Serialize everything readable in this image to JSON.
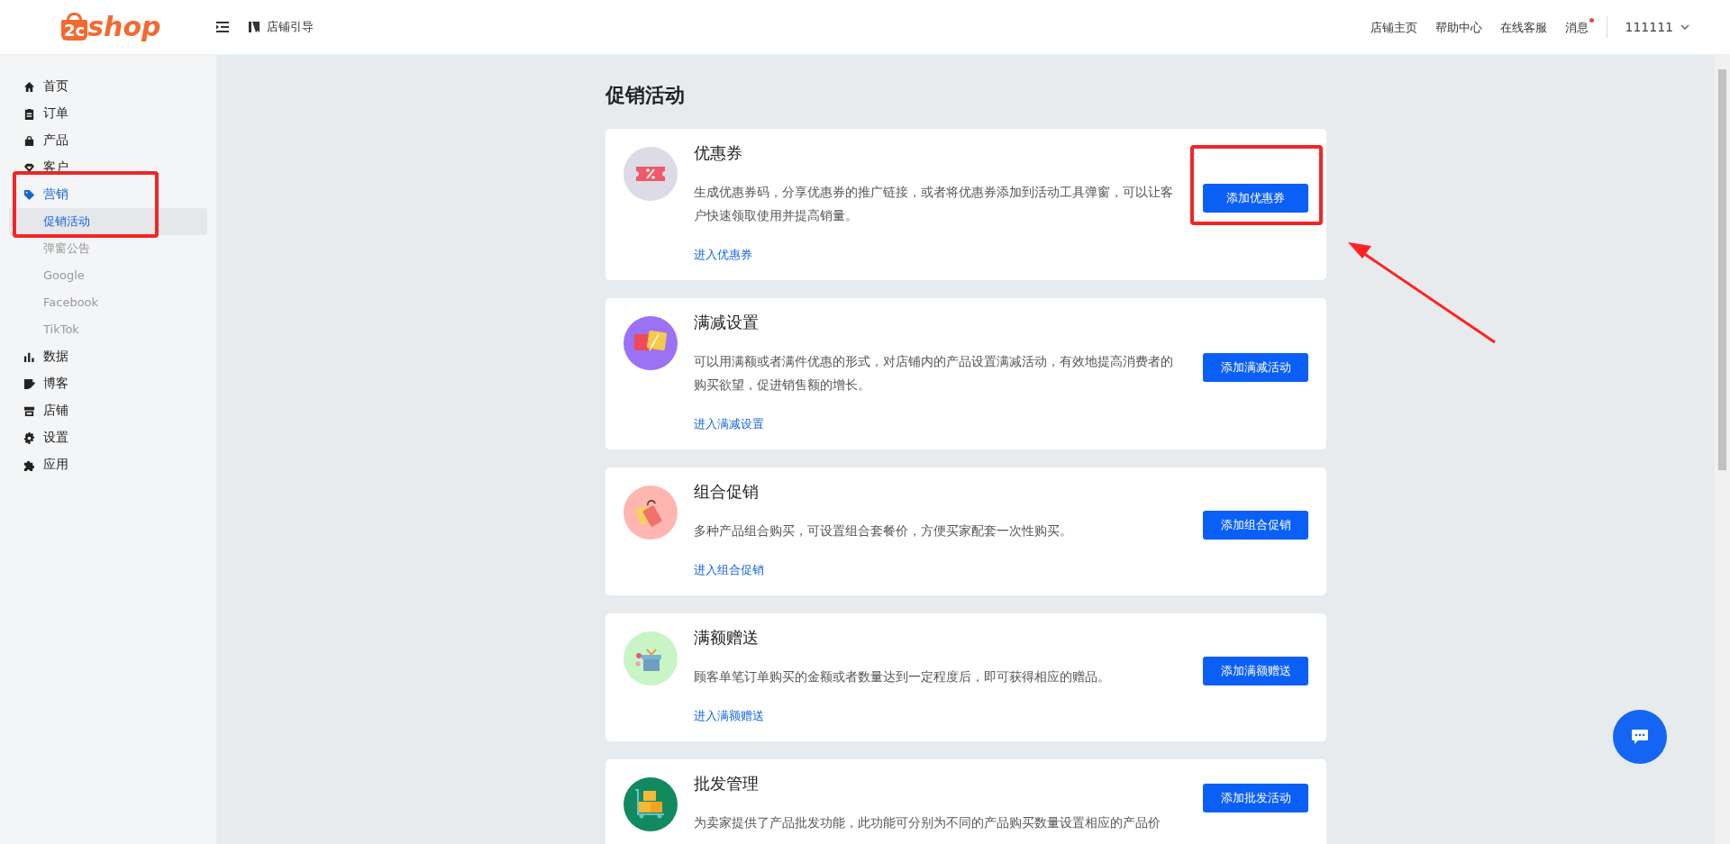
{
  "header": {
    "logo": {
      "mark": "2c",
      "word": "shop"
    },
    "guide": "店铺引导",
    "links": [
      {
        "label": "店铺主页",
        "badge": false
      },
      {
        "label": "帮助中心",
        "badge": false
      },
      {
        "label": "在线客服",
        "badge": false
      },
      {
        "label": "消息",
        "badge": true
      }
    ],
    "user": "111111"
  },
  "sidebar": {
    "items": [
      {
        "label": "首页",
        "kind": "home",
        "selected": false
      },
      {
        "label": "订单",
        "kind": "clipboard",
        "selected": false
      },
      {
        "label": "产品",
        "kind": "bag",
        "selected": false
      },
      {
        "label": "客户",
        "kind": "diamond",
        "selected": false
      },
      {
        "label": "营销",
        "kind": "tag",
        "selected": true,
        "expanded": true,
        "children": [
          {
            "label": "促销活动",
            "selected": true
          },
          {
            "label": "弹窗公告",
            "selected": false
          },
          {
            "label": "Google",
            "selected": false
          },
          {
            "label": "Facebook",
            "selected": false
          },
          {
            "label": "TikTok",
            "selected": false
          }
        ]
      },
      {
        "label": "数据",
        "kind": "chart",
        "selected": false
      },
      {
        "label": "博客",
        "kind": "edit",
        "selected": false
      },
      {
        "label": "店铺",
        "kind": "store",
        "selected": false
      },
      {
        "label": "设置",
        "kind": "gear",
        "selected": false
      },
      {
        "label": "应用",
        "kind": "puzzle",
        "selected": false
      }
    ]
  },
  "page_title": "促销活动",
  "cards": [
    {
      "kind": "coupon",
      "color": "#dcdbe6",
      "title": "优惠券",
      "description": "生成优惠券码，分享优惠券的推广链接，或者将优惠券添加到活动工具弹窗，可以让客户快速领取使用并提高销量。",
      "link": "进入优惠券",
      "button": "添加优惠券"
    },
    {
      "kind": "discount",
      "color": "#9c72f5",
      "title": "满减设置",
      "description": "可以用满额或者满件优惠的形式，对店铺内的产品设置满减活动，有效地提高消费者的购买欲望，促进销售额的增长。",
      "link": "进入满减设置",
      "button": "添加满减活动"
    },
    {
      "kind": "bundle",
      "color": "#ffb6b0",
      "title": "组合促销",
      "description": "多种产品组合购买，可设置组合套餐价，方便买家配套一次性购买。",
      "link": "进入组合促销",
      "button": "添加组合促销"
    },
    {
      "kind": "gift",
      "color": "#c9f5c6",
      "title": "满额赠送",
      "description": "顾客单笔订单购买的金额或者数量达到一定程度后，即可获得相应的赠品。",
      "link": "进入满额赠送",
      "button": "添加满额赠送"
    },
    {
      "kind": "wholesale",
      "color": "#128a60",
      "title": "批发管理",
      "description": "为卖家提供了产品批发功能，此功能可分别为不同的产品购买数量设置相应的产品价",
      "button": "添加批发活动"
    }
  ]
}
